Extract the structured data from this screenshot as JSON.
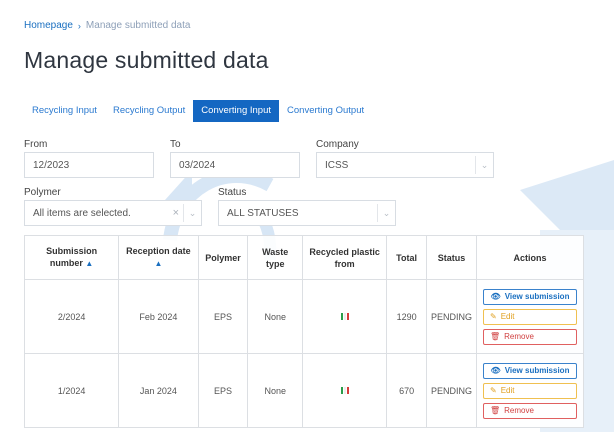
{
  "breadcrumb": {
    "home": "Homepage",
    "separator": "›",
    "current": "Manage submitted data"
  },
  "page_title": "Manage submitted data",
  "tabs": [
    {
      "label": "Recycling Input",
      "active": false
    },
    {
      "label": "Recycling Output",
      "active": false
    },
    {
      "label": "Converting Input",
      "active": true
    },
    {
      "label": "Converting Output",
      "active": false
    }
  ],
  "filters": {
    "from": {
      "label": "From",
      "value": "12/2023"
    },
    "to": {
      "label": "To",
      "value": "03/2024"
    },
    "company": {
      "label": "Company",
      "value": "ICSS"
    },
    "polymer": {
      "label": "Polymer",
      "value": "All items are selected."
    },
    "status": {
      "label": "Status",
      "value": "ALL STATUSES"
    }
  },
  "table": {
    "headers": {
      "submission_number": "Submission number",
      "reception_date": "Reception date",
      "polymer": "Polymer",
      "waste_type": "Waste type",
      "recycled_from": "Recycled plastic from",
      "total": "Total",
      "status": "Status",
      "actions": "Actions"
    },
    "rows": [
      {
        "number": "2/2024",
        "date": "Feb 2024",
        "polymer": "EPS",
        "waste": "None",
        "total": "1290",
        "status": "PENDING"
      },
      {
        "number": "1/2024",
        "date": "Jan 2024",
        "polymer": "EPS",
        "waste": "None",
        "total": "670",
        "status": "PENDING"
      }
    ],
    "actions": {
      "view": "View submission",
      "edit": "Edit",
      "remove": "Remove"
    }
  },
  "icons": {
    "sort": "sort-asc-icon",
    "flag": "italy-flag-icon",
    "eye": "eye-icon",
    "pencil": "pencil-icon",
    "trash": "trash-icon"
  },
  "colors": {
    "primary": "#1467c2",
    "link": "#1a6fc0",
    "edit": "#e0a020",
    "remove": "#d04040",
    "watermark": "#cfe0f2"
  }
}
